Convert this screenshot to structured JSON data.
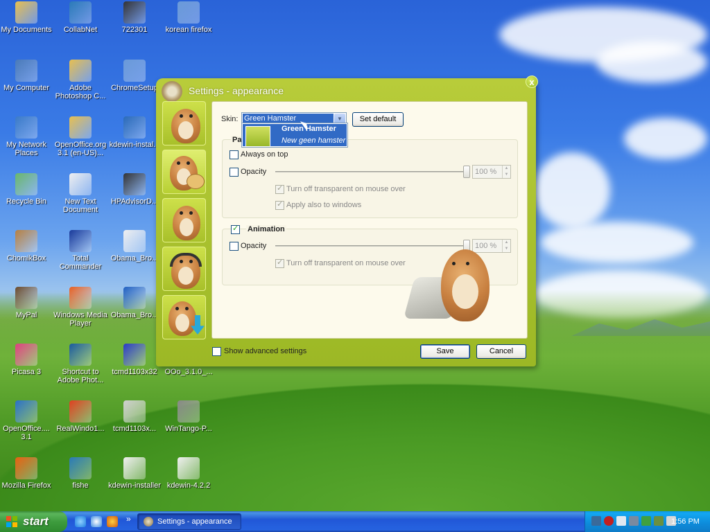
{
  "desktop": {
    "icons": [
      {
        "label": "My Documents",
        "icon": "folder-documents-icon"
      },
      {
        "label": "CollabNet",
        "icon": "collabnet-icon"
      },
      {
        "label": "722301",
        "icon": "7zip-archive-icon"
      },
      {
        "label": "korean firefox",
        "icon": "installer-cd-icon"
      },
      {
        "label": "My Computer",
        "icon": "computer-icon"
      },
      {
        "label": "Adobe Photoshop C...",
        "icon": "folder-icon"
      },
      {
        "label": "ChromeSetup",
        "icon": "installer-cd-icon"
      },
      {
        "label": "My Network Places",
        "icon": "network-icon"
      },
      {
        "label": "OpenOffice.org 3.1 (en-US)...",
        "icon": "folder-icon"
      },
      {
        "label": "kdewin-instal...",
        "icon": "kde-icon"
      },
      {
        "label": "Recycle Bin",
        "icon": "recycle-bin-icon"
      },
      {
        "label": "New Text Document",
        "icon": "text-document-icon"
      },
      {
        "label": "HPAdvisorD...",
        "icon": "flash-icon"
      },
      {
        "label": "ChomikBox",
        "icon": "chomikbox-icon"
      },
      {
        "label": "Total Commander",
        "icon": "floppy-icon"
      },
      {
        "label": "Obama_Bro...",
        "icon": "document-icon"
      },
      {
        "label": "MyPal",
        "icon": "raccoon-icon"
      },
      {
        "label": "Windows Media Player",
        "icon": "media-player-icon"
      },
      {
        "label": "Obama_Bro...",
        "icon": "obama-logo-icon"
      },
      {
        "label": "Picasa 3",
        "icon": "picasa-icon"
      },
      {
        "label": "Shortcut to Adobe Phot...",
        "icon": "photoshop-icon"
      },
      {
        "label": "tcmd1103x32",
        "icon": "floppy-icon"
      },
      {
        "label": "OOo_3.1.0_...",
        "icon": "folder-icon"
      },
      {
        "label": "OpenOffice.... 3.1",
        "icon": "openoffice-icon"
      },
      {
        "label": "RealWindo1...",
        "icon": "windows-logo-icon"
      },
      {
        "label": "tcmd1103x...",
        "icon": "window-icon"
      },
      {
        "label": "WinTango-P...",
        "icon": "tango-icon"
      },
      {
        "label": "Mozilla Firefox",
        "icon": "firefox-icon"
      },
      {
        "label": "fishe",
        "icon": "fish-icon"
      },
      {
        "label": "kdewin-installer",
        "icon": "document-icon"
      },
      {
        "label": "kdewin-4.2.2",
        "icon": "document-icon"
      }
    ]
  },
  "dialog": {
    "title": "Settings - appearance",
    "close_label": "x",
    "skin_label": "Skin:",
    "skin_value": "Green Hamster",
    "set_default_label": "Set default",
    "dropdown_title": "Green Hamster",
    "dropdown_subtitle": "New geen hamster",
    "panel_group_label": "Pan",
    "always_on_top": "Always on top",
    "opacity_label": "Opacity",
    "opacity_value": "100 %",
    "turn_off_transparent": "Turn off transparent on mouse over",
    "apply_windows": "Apply also to windows",
    "animation_label": "Animation",
    "animation_opacity_label": "Opacity",
    "animation_opacity_value": "100 %",
    "animation_turn_off": "Turn off transparent on mouse over",
    "show_advanced": "Show advanced settings",
    "save_label": "Save",
    "cancel_label": "Cancel",
    "checks": {
      "always_on_top": false,
      "opacity": false,
      "turn_off_transparent": true,
      "apply_windows": true,
      "animation": true,
      "animation_opacity": false,
      "animation_turn_off": true,
      "show_advanced": false
    },
    "opacity_level": 1.0,
    "animation_opacity_level": 1.0
  },
  "taskbar": {
    "start_label": "start",
    "task_label": "Settings - appearance",
    "clock": "1:56 PM",
    "overflow_label": "»"
  },
  "colors": {
    "dialog_green": "#a8c02a",
    "selection_blue": "#316ac5",
    "taskbar_blue": "#2157d7",
    "start_green": "#3e9c3e"
  }
}
